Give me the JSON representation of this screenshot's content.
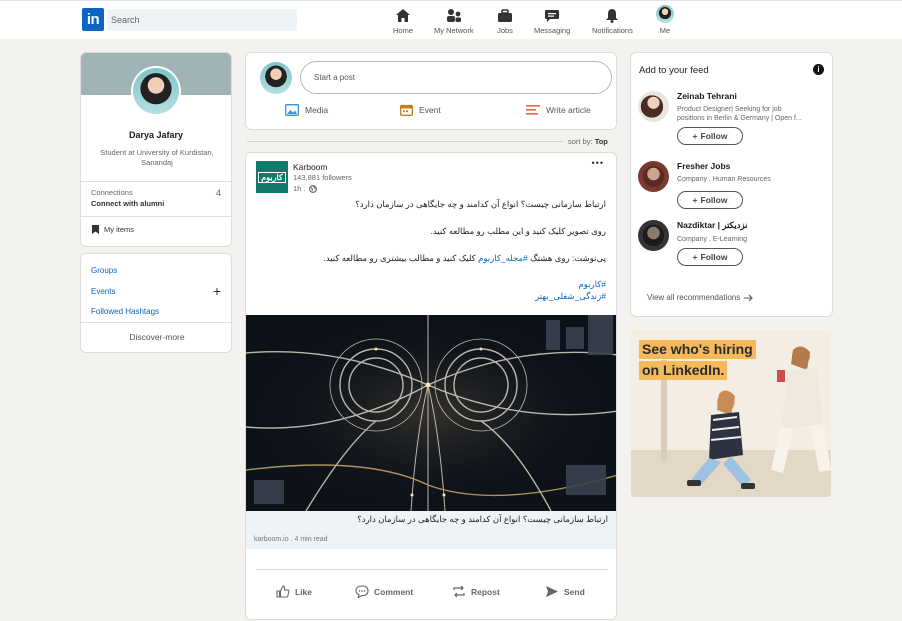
{
  "nav": {
    "search_placeholder": "Search",
    "items": [
      "Home",
      "My Network",
      "Jobs",
      "Messaging",
      "Notifications",
      "Me"
    ],
    "logo": "in"
  },
  "profile": {
    "name": "Darya Jafary",
    "headline": "Student at University of Kurdistan, Sanandaj",
    "connections_label": "Connections",
    "connections_count": "4",
    "connect_alumni": "Connect with alumni",
    "my_items": "My items"
  },
  "groups": {
    "links": [
      "Groups",
      "Events",
      "Followed Hashtags"
    ],
    "discover": "Discover-more"
  },
  "composer": {
    "placeholder": "Start a post",
    "actions": [
      "Media",
      "Event",
      "Write article"
    ]
  },
  "sort": {
    "label": "sort by:",
    "value": "Top"
  },
  "post": {
    "author": "Karboom",
    "logo_text": "کاربوم",
    "followers": "143,881 followers",
    "time": "1h .",
    "text_line1": "ارتباط سازمانی چیست؟ انواع آن کدامند و چه جایگاهی در سازمان دارد؟",
    "text_line2": "روی تصویر کلیک کنید و این مطلب رو مطالعه کنید.",
    "text_line3_before": "پی‌نوشت: روی هشتگ",
    "text_line3_tag": "#مجله_کاربوم",
    "text_line3_after": "کلیک کنید و مطالب بیشتری رو مطالعه کنید.",
    "hashtag1": "#کاربوم",
    "hashtag2": "#زندگی_شغلی_بهتر",
    "link_title": "ارتباط سازمانی چیست؟ انواع آن کدامند و چه جایگاهی در سازمان دارد؟",
    "link_source": "karboom.io",
    "link_read": "4 min read",
    "actions": [
      "Like",
      "Comment",
      "Repost",
      "Send"
    ],
    "more": "•••"
  },
  "feed": {
    "title": "Add to your feed",
    "recommendations": [
      {
        "name": "Zeinab Tehrani",
        "line1": "Product Designer| Seeking for job",
        "line2": "positions in Berlin & Germany | Open f..."
      },
      {
        "name": "Fresher Jobs",
        "line1": "Company . Human Resources",
        "line2": ""
      },
      {
        "name": "Nazdiktar | نزدیکتر",
        "line1": "Company . E-Learning",
        "line2": ""
      }
    ],
    "follow_label": "Follow",
    "view_all": "View all recommendations"
  },
  "ad": {
    "line1": "See who's hiring",
    "line2": "on LinkedIn."
  },
  "colors": {
    "brand": "#0a66c2",
    "background": "#f3f2ef",
    "ad_highlight": "#f3b95b",
    "karboom": "#127a6a"
  }
}
